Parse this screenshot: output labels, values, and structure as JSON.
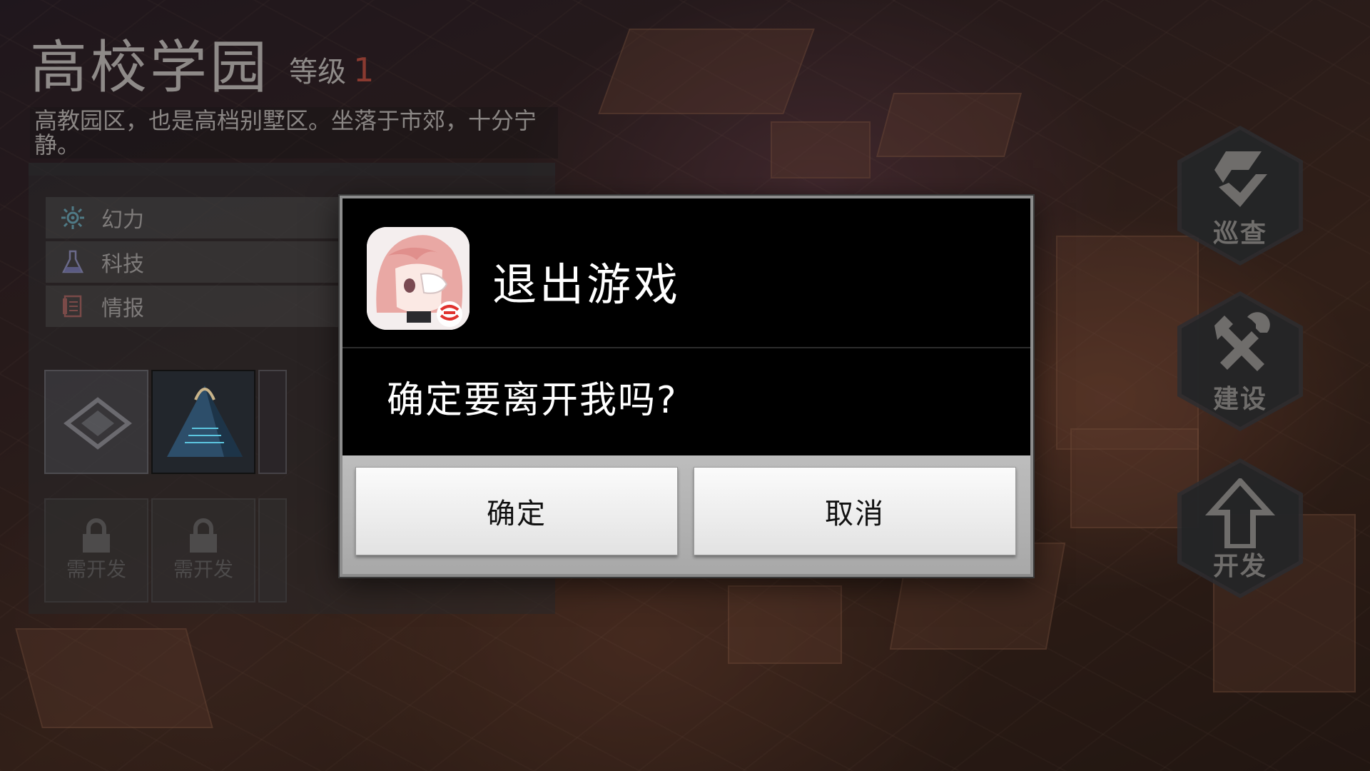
{
  "region": {
    "title": "高校学园",
    "level_label": "等级",
    "level_value": "1",
    "description": "高教园区，也是高档别墅区。坐落于市郊，十分宁静。"
  },
  "stats": [
    {
      "label": "幻力",
      "icon": "sparkle-icon"
    },
    {
      "label": "科技",
      "icon": "flask-icon"
    },
    {
      "label": "情报",
      "icon": "document-icon"
    }
  ],
  "tiles": {
    "locked_label": "需开发"
  },
  "side_buttons": {
    "patrol": "巡查",
    "build": "建设",
    "develop": "开发"
  },
  "dialog": {
    "title": "退出游戏",
    "message": "确定要离开我吗?",
    "confirm_label": "确定",
    "cancel_label": "取消"
  },
  "colors": {
    "dialog_bg": "#000000",
    "button_bg": "#f0f0f0",
    "level_accent": "#8a3a30"
  }
}
